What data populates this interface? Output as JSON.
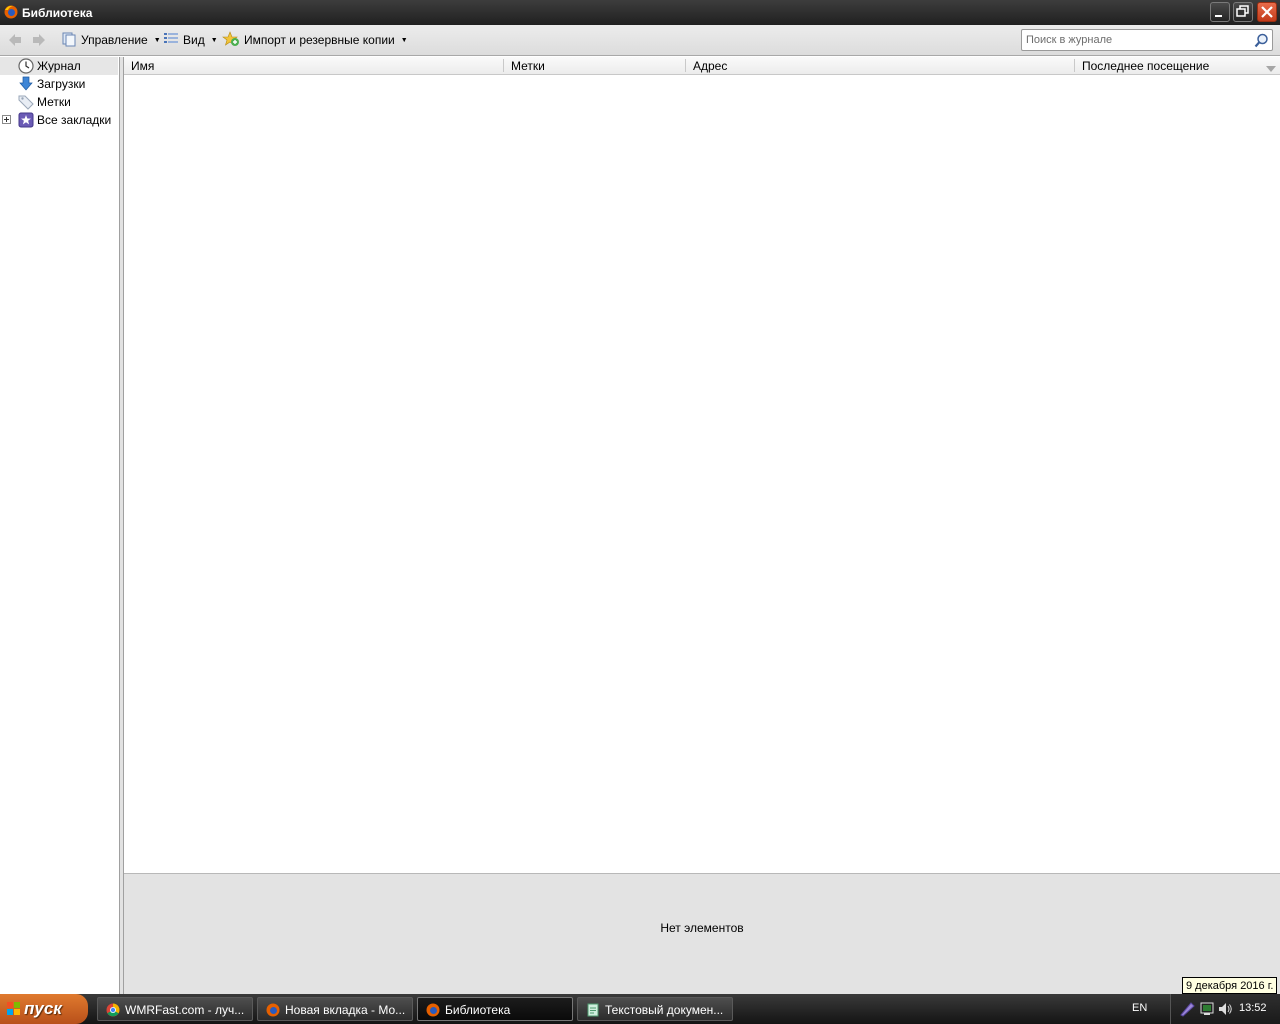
{
  "window": {
    "title": "Библиотека"
  },
  "toolbar": {
    "manage_label": "Управление",
    "view_label": "Вид",
    "import_label": "Импорт и резервные копии",
    "search_placeholder": "Поиск в журнале"
  },
  "sidebar": {
    "items": [
      {
        "label": "Журнал",
        "icon": "clock-icon",
        "selected": true
      },
      {
        "label": "Загрузки",
        "icon": "download-arrow-icon"
      },
      {
        "label": "Метки",
        "icon": "tag-icon"
      },
      {
        "label": "Все закладки",
        "icon": "bookmarks-star-icon",
        "expandable": true
      }
    ]
  },
  "table": {
    "columns": [
      "Имя",
      "Метки",
      "Адрес",
      "Последнее посещение"
    ],
    "rows": []
  },
  "details": {
    "empty_text": "Нет элементов"
  },
  "tooltip": "9 декабря 2016 г.",
  "taskbar": {
    "start_label": "пуск",
    "tasks": [
      {
        "label": "WMRFast.com - луч...",
        "icon": "chrome-icon"
      },
      {
        "label": "Новая вкладка - Мо...",
        "icon": "firefox-icon"
      },
      {
        "label": "Библиотека",
        "icon": "firefox-icon",
        "active": true
      },
      {
        "label": "Текстовый докумен...",
        "icon": "notepad-icon"
      }
    ],
    "language": "EN",
    "clock": "13:52"
  },
  "colors": {
    "start_orange": "#d36a26",
    "titlebar": "#2b2b2b",
    "selected_row": "#e6e6e6"
  }
}
